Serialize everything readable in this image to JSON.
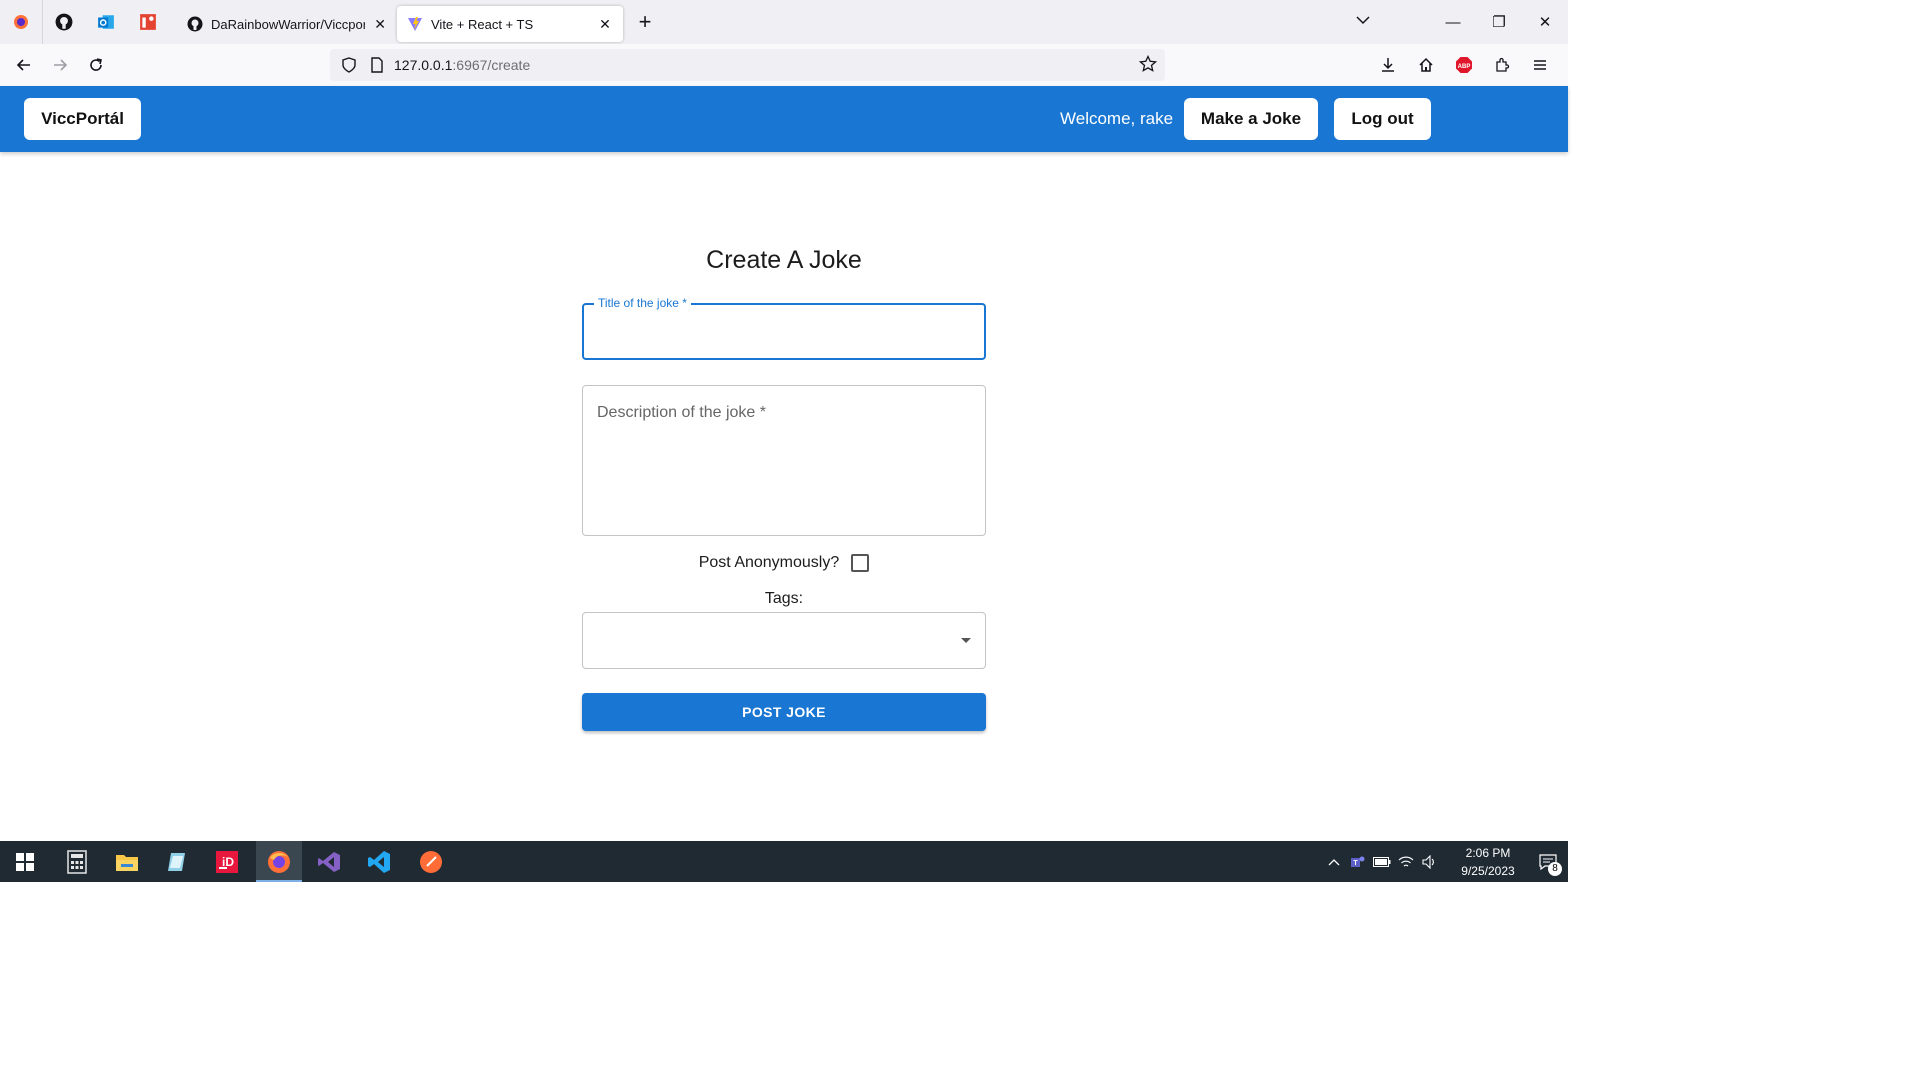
{
  "browser": {
    "tabs": [
      {
        "title": "DaRainbowWarrior/ViccportalS",
        "favicon": "github-icon",
        "active": false
      },
      {
        "title": "Vite + React + TS",
        "favicon": "vite-icon",
        "active": true
      }
    ],
    "pinned": [
      "firefox-icon",
      "github-icon",
      "outlook-icon",
      "tasks-icon"
    ],
    "url_host": "127.0.0.1",
    "url_path": ":6967/create"
  },
  "header": {
    "brand": "ViccPortál",
    "welcome": "Welcome, rake",
    "make_joke": "Make a Joke",
    "logout": "Log out",
    "color": "#1976d2"
  },
  "form": {
    "title": "Create A Joke",
    "title_field_label": "Title of the joke *",
    "description_placeholder": "Description of the joke *",
    "anonymous_label": "Post Anonymously?",
    "anonymous_checked": false,
    "tags_label": "Tags:",
    "submit": "POST JOKE"
  },
  "taskbar": {
    "apps": [
      "windows-start-icon",
      "calculator-icon",
      "file-explorer-icon",
      "notepad-icon",
      "intellij-icon",
      "firefox-icon",
      "visual-studio-icon",
      "vscode-icon",
      "postman-icon"
    ],
    "time": "2:06 PM",
    "date": "9/25/2023",
    "notifications": "8"
  }
}
